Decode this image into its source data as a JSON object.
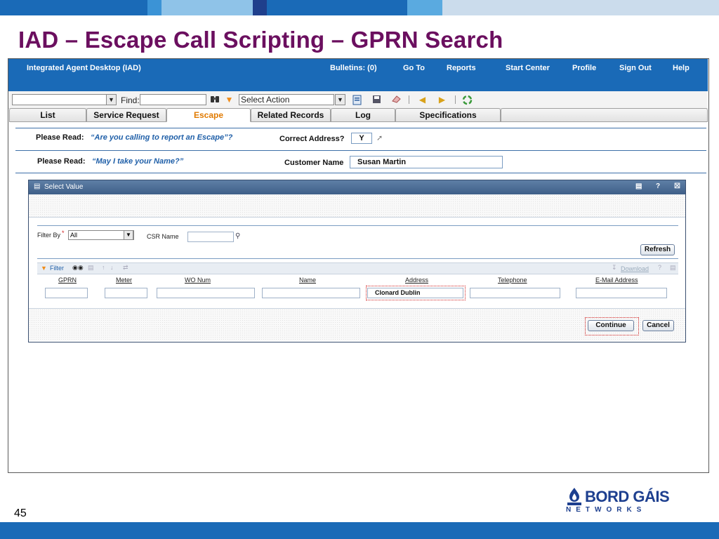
{
  "slide": {
    "title": "IAD – Escape Call Scripting – GPRN Search",
    "page_number": "45",
    "logo_text": "BORD GÁIS",
    "logo_subtext": "NETWORKS",
    "colors": {
      "title": "#6b0f5f",
      "brand_blue": "#1a6ab7",
      "logo": "#1d3f8f"
    }
  },
  "app": {
    "name": "Integrated Agent Desktop (IAD)",
    "nav": [
      {
        "label": "Bulletins: (0)"
      },
      {
        "label": "Go To"
      },
      {
        "label": "Reports"
      },
      {
        "label": "Start Center"
      },
      {
        "label": "Profile"
      },
      {
        "label": "Sign Out"
      },
      {
        "label": "Help"
      }
    ]
  },
  "toolbar": {
    "find_label": "Find:",
    "select_action": "Select Action",
    "icons": [
      "binoculars-icon",
      "chevron-down-icon",
      "new-record-icon",
      "save-icon",
      "clear-icon",
      "previous-icon",
      "next-icon",
      "refresh-icon"
    ]
  },
  "tabs": [
    "List",
    "Service Request",
    "Escape",
    "Related Records",
    "Log",
    "Specifications"
  ],
  "active_tab": "Escape",
  "script": {
    "row1": {
      "please_read": "Please Read:",
      "prompt": "“Are you calling to report an Escape”?",
      "field_label": "Correct Address?",
      "field_value": "Y"
    },
    "row2": {
      "please_read": "Please Read:",
      "prompt": "“May I take your Name?”",
      "field_label": "Customer Name",
      "field_value": "Susan Martin"
    }
  },
  "dialog": {
    "title": "Select Value",
    "filter_by_label": "Filter By",
    "filter_by_value": "All",
    "csr_name_label": "CSR Name",
    "refresh_label": "Refresh",
    "filter_label": "Filter",
    "download_label": "Download",
    "columns": [
      "GPRN",
      "Meter",
      "WO Num",
      "Name",
      "Address",
      "Telephone",
      "E-Mail Address"
    ],
    "filter_values": {
      "address": "Clonard Dublin"
    },
    "continue_label": "Continue",
    "cancel_label": "Cancel"
  }
}
